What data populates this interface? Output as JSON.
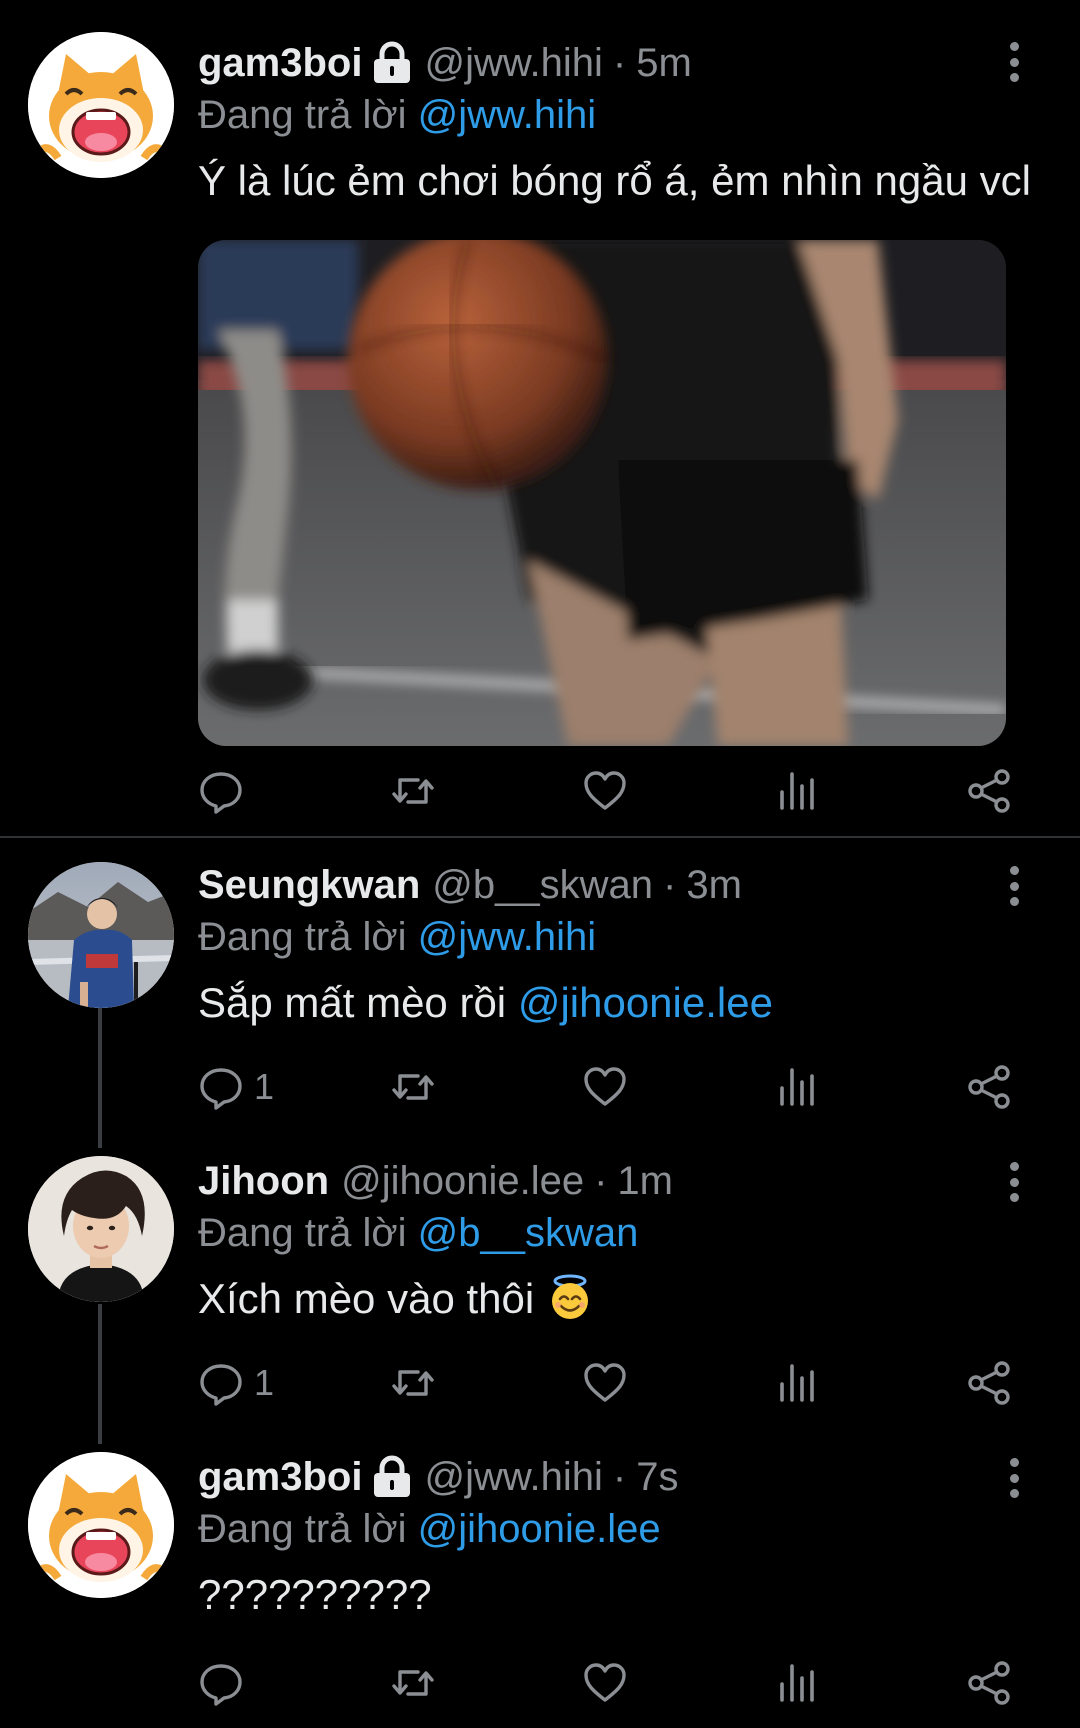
{
  "colors": {
    "background": "#000000",
    "text_primary": "#e7e9ea",
    "text_secondary": "#8b8f94",
    "mention": "#2f9ce8"
  },
  "tweets": [
    {
      "display_name": "gam3boi",
      "protected": true,
      "handle": "@jww.hihi",
      "separator": "·",
      "time": "5m",
      "replying_prefix": "Đang trả lời",
      "replying_to": "@jww.hihi",
      "text": "Ý là lúc ẻm chơi bóng rổ á, ẻm nhìn ngầu vcl",
      "has_media": true,
      "reply_count": ""
    },
    {
      "display_name": "Seungkwan",
      "protected": false,
      "handle": "@b__skwan",
      "separator": "·",
      "time": "3m",
      "replying_prefix": "Đang trả lời",
      "replying_to": "@jww.hihi",
      "text": "Sắp mất mèo rồi ",
      "text_mention": "@jihoonie.lee",
      "reply_count": "1"
    },
    {
      "display_name": "Jihoon",
      "protected": false,
      "handle": "@jihoonie.lee",
      "separator": "·",
      "time": "1m",
      "replying_prefix": "Đang trả lời",
      "replying_to": "@b__skwan",
      "text": "Xích mèo vào thôi ",
      "emoji": "smiling-face-with-halo",
      "reply_count": "1"
    },
    {
      "display_name": "gam3boi",
      "protected": true,
      "handle": "@jww.hihi",
      "separator": "·",
      "time": "7s",
      "replying_prefix": "Đang trả lời",
      "replying_to": "@jihoonie.lee",
      "text": "??????????",
      "reply_count": ""
    }
  ],
  "icons": {
    "reply": "reply-icon",
    "retweet": "retweet-icon",
    "like": "heart-icon",
    "views": "views-icon",
    "share": "share-icon",
    "more": "more-icon",
    "protected": "lock-icon"
  }
}
